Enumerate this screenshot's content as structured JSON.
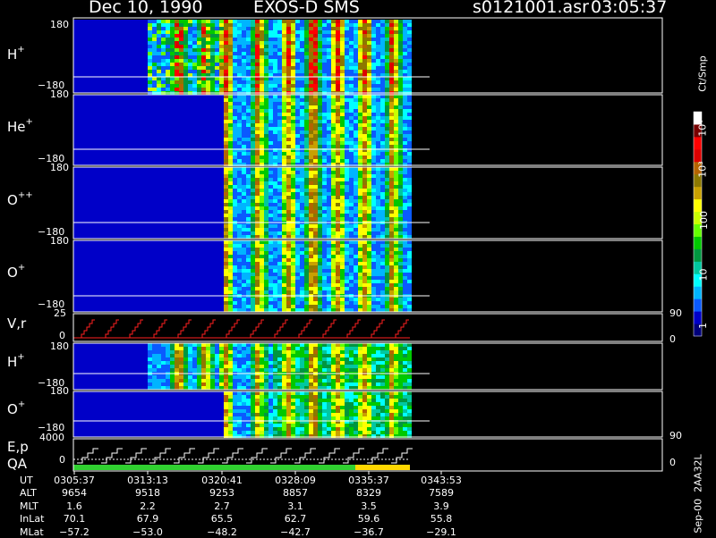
{
  "header": {
    "date": "Dec 10, 1990",
    "instrument": "EXOS-D SMS",
    "file": "s0121001.asr",
    "time": "03:05:37"
  },
  "colorbar": {
    "unit_label": "Ct/Smp",
    "tick_labels": [
      "1",
      "10",
      "100",
      "10³",
      "10⁴"
    ],
    "colors": [
      "#00007a",
      "#0000c8",
      "#0a5aff",
      "#00b4ff",
      "#00ffff",
      "#00c8a0",
      "#009640",
      "#00c800",
      "#64ff00",
      "#c8ff00",
      "#ffff00",
      "#c8a000",
      "#8c7800",
      "#b46400",
      "#dc0000",
      "#ff0000",
      "#780000",
      "#ffffff"
    ]
  },
  "right_axis": {
    "vr_top": "90",
    "vr_bottom": "0",
    "ep_top": "90",
    "ep_bottom": "0"
  },
  "side_note": "Sep-00  2AA32L",
  "panels": [
    {
      "label": "H",
      "sup": "+",
      "top": "180",
      "bottom": "−180"
    },
    {
      "label": "He",
      "sup": "+",
      "top": "180",
      "bottom": "−180"
    },
    {
      "label": "O",
      "sup": "++",
      "top": "180",
      "bottom": "−180"
    },
    {
      "label": "O",
      "sup": "+",
      "top": "180",
      "bottom": "−180"
    },
    {
      "label": "V,r",
      "sup": "",
      "top": "25",
      "bottom": "0"
    },
    {
      "label": "H",
      "sup": "+",
      "top": "180",
      "bottom": "−180"
    },
    {
      "label": "O",
      "sup": "+",
      "top": "180",
      "bottom": "−180"
    },
    {
      "label": "E,p",
      "sup": "",
      "top": "4000",
      "bottom": "0"
    }
  ],
  "qa_label": "QA",
  "info_table": {
    "labels": [
      "UT",
      "ALT",
      "MLT",
      "InLat",
      "MLat"
    ],
    "columns": [
      {
        "UT": "0305:37",
        "ALT": "9654",
        "MLT": "1.6",
        "InLat": "70.1",
        "MLat": "−57.2"
      },
      {
        "UT": "0313:13",
        "ALT": "9518",
        "MLT": "2.2",
        "InLat": "67.9",
        "MLat": "−53.0"
      },
      {
        "UT": "0320:41",
        "ALT": "9253",
        "MLT": "2.7",
        "InLat": "65.5",
        "MLat": "−48.2"
      },
      {
        "UT": "0328:09",
        "ALT": "8857",
        "MLT": "3.1",
        "InLat": "62.7",
        "MLat": "−42.7"
      },
      {
        "UT": "0335:37",
        "ALT": "8329",
        "MLT": "3.5",
        "InLat": "59.6",
        "MLat": "−36.7"
      },
      {
        "UT": "0343:53",
        "ALT": "7589",
        "MLT": "3.9",
        "InLat": "55.8",
        "MLat": "−29.1"
      }
    ]
  },
  "chart_data": {
    "type": "heatmap",
    "title": "Dec 10, 1990   EXOS-D SMS",
    "colorbar_label": "Ct/Smp",
    "colorbar_scale": "log",
    "colorbar_range": [
      1,
      10000
    ],
    "x_tick_labels": [
      "0305:37",
      "0313:13",
      "0320:41",
      "0328:09",
      "0335:37",
      "0343:53"
    ],
    "panels": [
      {
        "name": "H+",
        "ylim": [
          -180,
          180
        ]
      },
      {
        "name": "He+",
        "ylim": [
          -180,
          180
        ]
      },
      {
        "name": "O++",
        "ylim": [
          -180,
          180
        ]
      },
      {
        "name": "O+",
        "ylim": [
          -180,
          180
        ]
      },
      {
        "name": "V,r",
        "ylim": [
          0,
          25
        ]
      },
      {
        "name": "H+",
        "ylim": [
          -180,
          180
        ]
      },
      {
        "name": "O+",
        "ylim": [
          -180,
          180
        ]
      },
      {
        "name": "E,p",
        "ylim": [
          0,
          4000
        ]
      }
    ],
    "data_end_fraction": 0.98
  }
}
